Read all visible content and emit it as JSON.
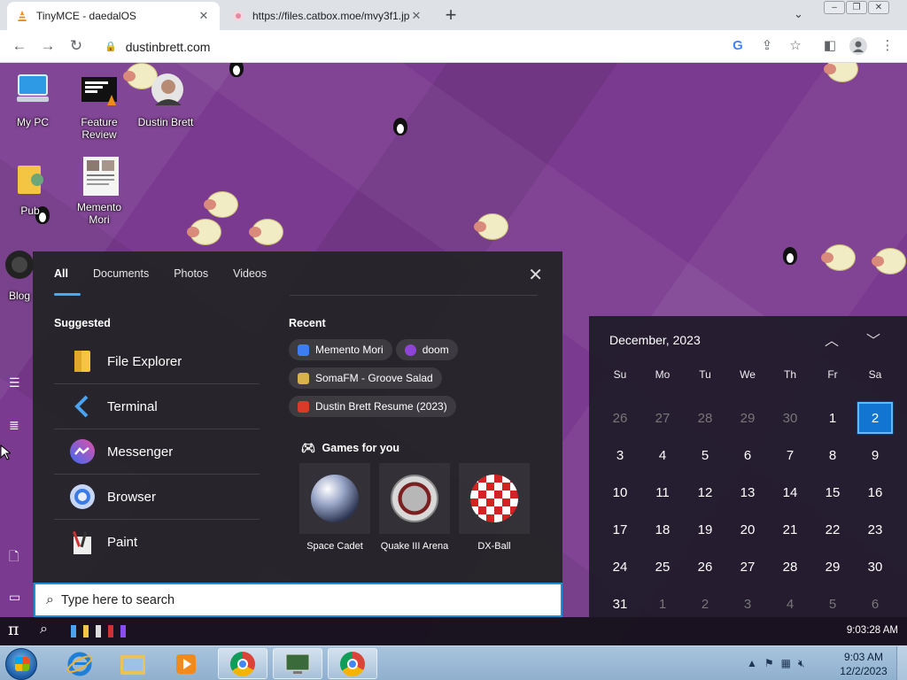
{
  "browser": {
    "tabs": [
      {
        "title": "TinyMCE - daedalOS",
        "active": true
      },
      {
        "title": "https://files.catbox.moe/mvy3f1.jp",
        "active": false
      }
    ],
    "new_tab": "+",
    "tab_search": "⌄",
    "window_buttons": [
      "–",
      "❐",
      "✕"
    ],
    "url": "dustinbrett.com"
  },
  "desktop_icons": [
    {
      "label": "My PC"
    },
    {
      "label": "Feature Review"
    },
    {
      "label": "Dustin Brett"
    },
    {
      "label": "Pub"
    },
    {
      "label": "Memento Mori"
    },
    {
      "label": "Blog"
    }
  ],
  "start_menu": {
    "tabs": [
      "All",
      "Documents",
      "Photos",
      "Videos"
    ],
    "active_tab": "All",
    "suggested_header": "Suggested",
    "suggested": [
      {
        "label": "File Explorer",
        "icon": "folder-icon",
        "color": "#f4c542"
      },
      {
        "label": "Terminal",
        "icon": "terminal-icon",
        "color": "#4aa3f0"
      },
      {
        "label": "Messenger",
        "icon": "messenger-icon",
        "color": "#8a4df0"
      },
      {
        "label": "Browser",
        "icon": "browser-icon",
        "color": "#3b7be8"
      },
      {
        "label": "Paint",
        "icon": "paint-icon",
        "color": "#e9e9e9"
      }
    ],
    "recent_header": "Recent",
    "recent": [
      {
        "label": "Memento Mori",
        "color": "#3d7cf2"
      },
      {
        "label": "doom",
        "color": "#8e44d6"
      },
      {
        "label": "SomaFM - Groove Salad",
        "color": "#d8b24a"
      },
      {
        "label": "Dustin Brett Resume (2023)",
        "color": "#d93a2b"
      }
    ],
    "games_header": "Games for you",
    "games": [
      {
        "label": "Space Cadet"
      },
      {
        "label": "Quake III Arena"
      },
      {
        "label": "DX-Ball"
      }
    ],
    "search_placeholder": "Type here to search"
  },
  "calendar": {
    "title": "December, 2023",
    "weekdays": [
      "Su",
      "Mo",
      "Tu",
      "We",
      "Th",
      "Fr",
      "Sa"
    ],
    "days": [
      {
        "d": "26",
        "muted": true
      },
      {
        "d": "27",
        "muted": true
      },
      {
        "d": "28",
        "muted": true
      },
      {
        "d": "29",
        "muted": true
      },
      {
        "d": "30",
        "muted": true
      },
      {
        "d": "1"
      },
      {
        "d": "2",
        "today": true
      },
      {
        "d": "3"
      },
      {
        "d": "4"
      },
      {
        "d": "5"
      },
      {
        "d": "6"
      },
      {
        "d": "7"
      },
      {
        "d": "8"
      },
      {
        "d": "9"
      },
      {
        "d": "10"
      },
      {
        "d": "11"
      },
      {
        "d": "12"
      },
      {
        "d": "13"
      },
      {
        "d": "14"
      },
      {
        "d": "15"
      },
      {
        "d": "16"
      },
      {
        "d": "17"
      },
      {
        "d": "18"
      },
      {
        "d": "19"
      },
      {
        "d": "20"
      },
      {
        "d": "21"
      },
      {
        "d": "22"
      },
      {
        "d": "23"
      },
      {
        "d": "24"
      },
      {
        "d": "25"
      },
      {
        "d": "26"
      },
      {
        "d": "27"
      },
      {
        "d": "28"
      },
      {
        "d": "29"
      },
      {
        "d": "30"
      },
      {
        "d": "31"
      },
      {
        "d": "1",
        "muted": true
      },
      {
        "d": "2",
        "muted": true
      },
      {
        "d": "3",
        "muted": true
      },
      {
        "d": "4",
        "muted": true
      },
      {
        "d": "5",
        "muted": true
      },
      {
        "d": "6",
        "muted": true
      }
    ]
  },
  "daedal_taskbar": {
    "start_glyph": "π",
    "clock": "9:03:28 AM"
  },
  "win7_taskbar": {
    "time": "9:03 AM",
    "date": "12/2/2023"
  },
  "colors": {
    "accent": "#1275d1",
    "desktop": "#7a3a8f",
    "search_border": "#1c8fd9"
  }
}
